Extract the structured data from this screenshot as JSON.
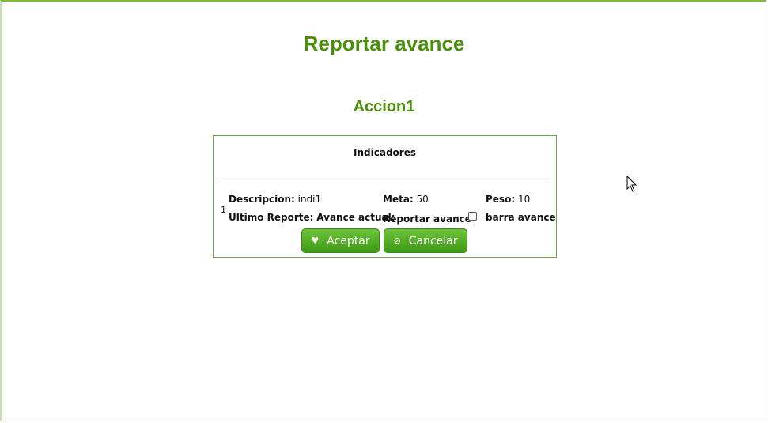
{
  "page": {
    "title": "Reportar avance"
  },
  "section": {
    "title": "Accion1"
  },
  "panel": {
    "header": "Indicadores",
    "row": {
      "number": "1",
      "descripcion_label": "Descripcion:",
      "descripcion_value": "indi1",
      "meta_label": "Meta:",
      "meta_value": "50",
      "peso_label": "Peso:",
      "peso_value": "10",
      "ultimo_reporte_label": "Ultimo Reporte:",
      "avance_actual_label": "Avance actual:",
      "reportar_avance_label": "Reportar avance",
      "barra_avance_label": "barra avance"
    },
    "buttons": {
      "accept": "Aceptar",
      "cancel": "Cancelar"
    }
  },
  "icons": {
    "accept": "heart-icon",
    "cancel": "ban-icon",
    "cursor": "mouse-pointer-icon"
  },
  "colors": {
    "accent": "#4a8e0a",
    "button": "#52ad24",
    "border": "#6aa84f"
  }
}
